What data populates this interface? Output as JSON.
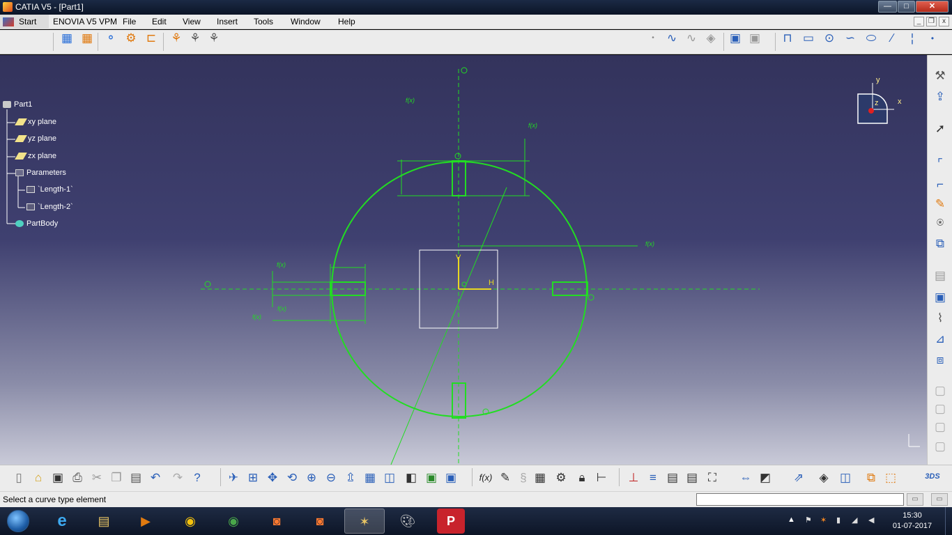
{
  "window": {
    "title": "CATIA V5 - [Part1]"
  },
  "titlebar_buttons": {
    "minimize": "—",
    "maximize": "□",
    "close": "✕"
  },
  "menubar": {
    "start": "Start",
    "items": [
      "ENOVIA V5 VPM",
      "File",
      "Edit",
      "View",
      "Insert",
      "Tools",
      "Window",
      "Help"
    ],
    "mdi": {
      "minimize": "_",
      "restore": "❐",
      "close": "x"
    }
  },
  "top_toolbar": {
    "icons": [
      "grid-icon",
      "snap-to-point-icon",
      "construction-elements-icon",
      "geometrical-constraints-icon",
      "dimensional-constraints-icon",
      "automatic-dimensional-constraints-icon",
      "edit-multi-constraint-icon",
      "animate-constraint-icon",
      "point-icon",
      "spline-icon",
      "connect-icon",
      "eraser-icon",
      "profile-icon",
      "rectangle-icon",
      "circle-icon",
      "arc-icon",
      "ellipse-icon",
      "line-icon",
      "axis-icon",
      "point-icon"
    ]
  },
  "tree": {
    "root": "Part1",
    "items": [
      "xy plane",
      "yz plane",
      "zx plane",
      "Parameters",
      "`Length-1`",
      "`Length-2`",
      "PartBody"
    ]
  },
  "compass": {
    "x": "x",
    "y": "y",
    "z": "z"
  },
  "sketch_labels": {
    "f1": "f(x)",
    "f2": "f(x)",
    "f3": "f(x)",
    "f4": "f(x)",
    "f5": "f(x)",
    "f6": "f(x)",
    "axis_h": "H",
    "axis_v": "V"
  },
  "right_toolbar": {
    "icons": [
      "exit-workbench-icon",
      "sketch-icon",
      "select-arrow-icon",
      "corner-icon",
      "chamfer-icon",
      "trim-icon",
      "mirror-icon",
      "project-3d-elements-icon",
      "pad-icon",
      "pocket-icon",
      "shaft-icon",
      "groove-icon",
      "hole-icon",
      "rib-icon",
      "slot-icon",
      "stiffener-icon",
      "loft-icon",
      "remove-loft-icon"
    ]
  },
  "bottom_toolbar": {
    "icons": [
      "new-icon",
      "open-icon",
      "save-icon",
      "print-icon",
      "cut-icon",
      "copy-icon",
      "paste-icon",
      "undo-icon",
      "redo-icon",
      "whats-this-icon",
      "fly-mode-icon",
      "fit-all-in-icon",
      "pan-icon",
      "rotate-icon",
      "zoom-in-icon",
      "zoom-out-icon",
      "normal-view-icon",
      "isometric-view-icon",
      "view-mode-icon",
      "shading-icon",
      "hide-show-icon",
      "swap-visible-space-icon",
      "formula-icon",
      "comment-icon",
      "law-icon",
      "design-table-icon",
      "knowledge-icon",
      "lock-icon",
      "measure-icon",
      "constraints-icon",
      "analysis-icon",
      "geometric-set-icon",
      "ordered-geometric-set-icon",
      "catalog-icon",
      "sketch-analysis-icon",
      "apply-material-icon",
      "measure-between-icon",
      "3d-compass-icon",
      "part-design-icon",
      "boolean-icon",
      "surface-icon",
      "catia-logo-icon"
    ]
  },
  "status": {
    "message": "Select a curve type element",
    "command_value": ""
  },
  "taskbar": {
    "apps": [
      "internet-explorer-icon",
      "file-explorer-icon",
      "media-player-icon",
      "chrome-canary-icon",
      "chrome-icon",
      "capture-icon",
      "screenshot-icon",
      "catia-v5-icon",
      "paint-icon",
      "pinterest-icon"
    ],
    "time": "15:30",
    "date": "01-07-2017"
  },
  "colors": {
    "viewport_top": "#33335c",
    "viewport_bottom": "#c9cad8",
    "sketch_green": "#22dd22",
    "tree_text": "#ffffff",
    "axis_yellow": "#e8d820"
  }
}
